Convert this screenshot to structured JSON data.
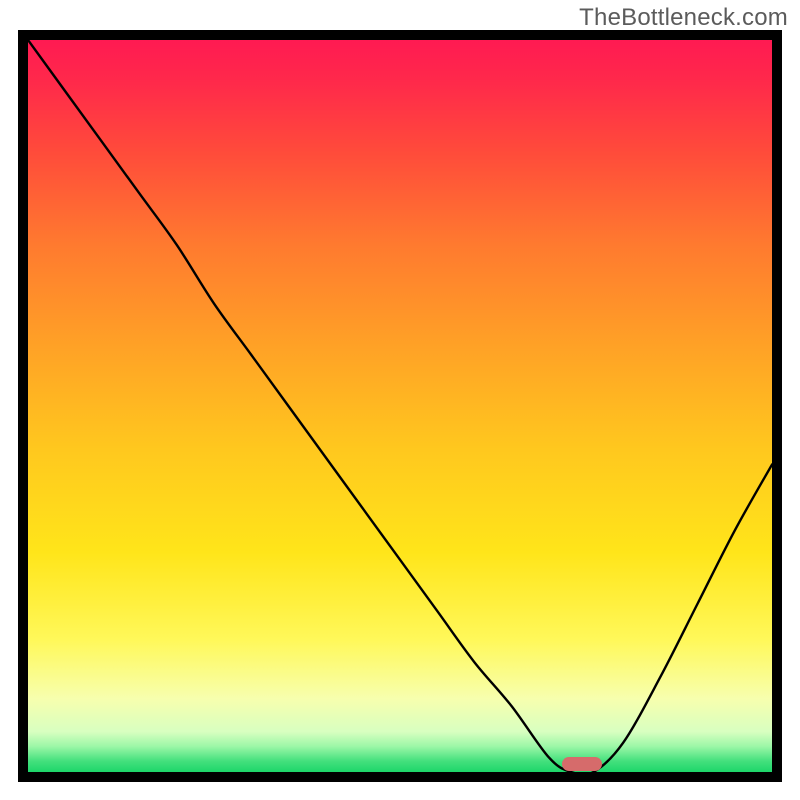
{
  "watermark": "TheBottleneck.com",
  "colors": {
    "curve": "#000000",
    "marker": "#d66b6b",
    "frame": "#000000"
  },
  "gradient_stops": [
    {
      "offset": 0.0,
      "color": "#ff1a52"
    },
    {
      "offset": 0.06,
      "color": "#ff2a4a"
    },
    {
      "offset": 0.15,
      "color": "#ff4a3b"
    },
    {
      "offset": 0.28,
      "color": "#ff7a2f"
    },
    {
      "offset": 0.42,
      "color": "#ffa226"
    },
    {
      "offset": 0.56,
      "color": "#ffc81e"
    },
    {
      "offset": 0.7,
      "color": "#ffe51a"
    },
    {
      "offset": 0.82,
      "color": "#fff85a"
    },
    {
      "offset": 0.9,
      "color": "#f7ffae"
    },
    {
      "offset": 0.945,
      "color": "#d8ffc0"
    },
    {
      "offset": 0.965,
      "color": "#9cf7a7"
    },
    {
      "offset": 0.985,
      "color": "#44e07d"
    },
    {
      "offset": 1.0,
      "color": "#1dd66a"
    }
  ],
  "chart_data": {
    "type": "line",
    "title": "",
    "xlabel": "",
    "ylabel": "",
    "x_range": [
      0,
      100
    ],
    "y_range": [
      0,
      100
    ],
    "x": [
      0,
      5,
      10,
      15,
      20,
      25,
      30,
      35,
      40,
      45,
      50,
      55,
      60,
      65,
      70,
      73,
      76,
      80,
      85,
      90,
      95,
      100
    ],
    "y": [
      100,
      93,
      86,
      79,
      72,
      64,
      57,
      50,
      43,
      36,
      29,
      22,
      15,
      9,
      2,
      0,
      0,
      4,
      13,
      23,
      33,
      42
    ],
    "marker": {
      "x": 74.5,
      "y": 0
    },
    "note": "x and y are plotted in percent of the inner plot area; y=0 is the bottom edge (green), y=100 is the top (red)."
  }
}
